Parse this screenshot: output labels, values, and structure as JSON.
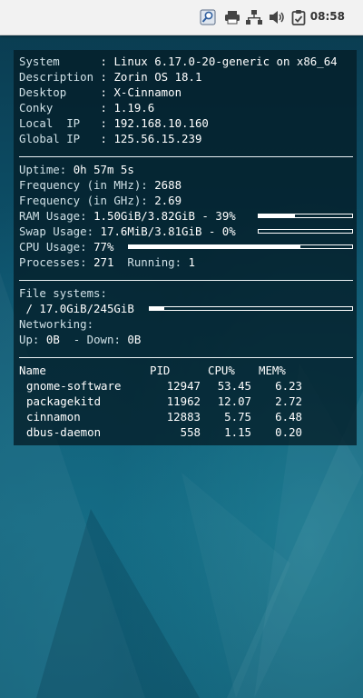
{
  "panel": {
    "clock": "08:58",
    "tray_icons": [
      "search-icon",
      "printer-icon",
      "network-icon",
      "volume-icon",
      "clipboard-icon"
    ]
  },
  "conky": {
    "system": [
      {
        "key": "System     ",
        "value": "Linux 6.17.0-20-generic on x86_64"
      },
      {
        "key": "Description",
        "value": "Zorin OS 18.1"
      },
      {
        "key": "Desktop    ",
        "value": "X-Cinnamon"
      },
      {
        "key": "Conky      ",
        "value": "1.19.6"
      },
      {
        "key": "Local  IP  ",
        "value": "192.168.10.160"
      },
      {
        "key": "Global IP  ",
        "value": "125.56.15.239"
      }
    ],
    "uptime_label": "Uptime:",
    "uptime_value": "0h 57m 5s",
    "freq_mhz_label": "Frequency (in MHz):",
    "freq_mhz_value": "2688",
    "freq_ghz_label": "Frequency (in GHz):",
    "freq_ghz_value": "2.69",
    "ram_label": "RAM Usage:",
    "ram_value": "1.50GiB/3.82GiB - 39%",
    "ram_fraction": 0.39,
    "swap_label": "Swap Usage:",
    "swap_value": "17.6MiB/3.81GiB - 0%",
    "swap_fraction": 0.0,
    "cpu_label": "CPU Usage:",
    "cpu_value": "77%",
    "cpu_fraction": 0.77,
    "processes_label": "Processes:",
    "processes_value": "271",
    "running_label": "Running:",
    "running_value": "1",
    "fs_label": "File systems:",
    "fs_value": " / 17.0GiB/245GiB",
    "fs_fraction": 0.07,
    "net_label": "Networking:",
    "up_label": "Up:",
    "up_value": "0B",
    "down_label": "  - Down:",
    "down_value": "0B",
    "proc_headers": [
      "Name",
      "PID",
      "CPU%",
      "MEM%"
    ],
    "procs": [
      {
        "name": "gnome-software",
        "pid": "12947",
        "cpu": "53.45",
        "mem": "6.23"
      },
      {
        "name": "packagekitd",
        "pid": "11962",
        "cpu": "12.07",
        "mem": "2.72"
      },
      {
        "name": "cinnamon",
        "pid": "12883",
        "cpu": "5.75",
        "mem": "6.48"
      },
      {
        "name": "dbus-daemon",
        "pid": "558",
        "cpu": "1.15",
        "mem": "0.20"
      }
    ]
  },
  "colors": {
    "panel_bg": "#f2f2f2",
    "conky_bg": "#041c26",
    "desktop_bg": "#0d4f66"
  }
}
